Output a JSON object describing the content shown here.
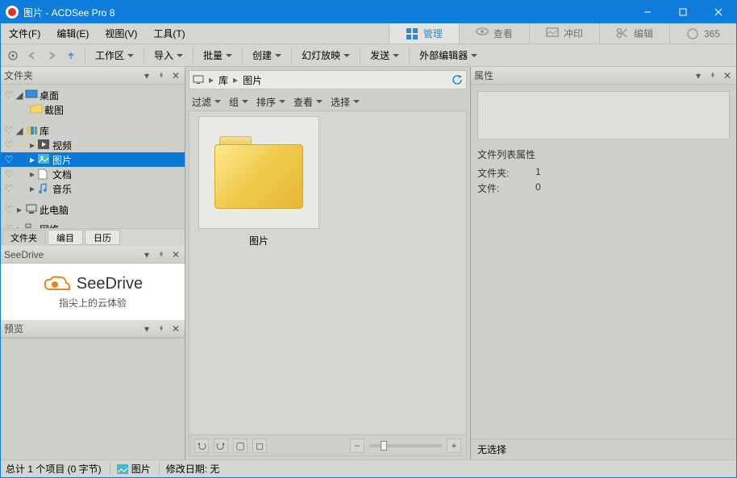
{
  "title": "图片 - ACDSee Pro 8",
  "menu": [
    "文件(F)",
    "编辑(E)",
    "视图(V)",
    "工具(T)"
  ],
  "modes": {
    "manage": "管理",
    "view": "查看",
    "develop": "冲印",
    "edit": "编辑",
    "365": "365"
  },
  "toolbar": {
    "workspace": "工作区",
    "import": "导入",
    "batch": "批量",
    "create": "创建",
    "slide": "幻灯放映",
    "send": "发送",
    "external": "外部编辑器"
  },
  "folders_panel": {
    "title": "文件夹"
  },
  "tree": {
    "desktop": "桌面",
    "screenshots": "截图",
    "library": "库",
    "videos": "视频",
    "pictures": "图片",
    "documents": "文档",
    "music": "音乐",
    "thispc": "此电脑",
    "network": "网络"
  },
  "left_tabs": {
    "folders": "文件夹",
    "catalog": "编目",
    "calendar": "日历"
  },
  "seedrive_panel": {
    "title": "SeeDrive",
    "brand": "SeeDrive",
    "tagline": "指尖上的云体验"
  },
  "preview_panel": {
    "title": "预览"
  },
  "breadcrumb": {
    "lib": "库",
    "pictures": "图片"
  },
  "filters": {
    "filter": "过滤",
    "group": "组",
    "sort": "排序",
    "view": "查看",
    "select": "选择"
  },
  "item": {
    "label": "图片"
  },
  "props_panel": {
    "title": "属性",
    "section": "文件列表属性",
    "folders_k": "文件夹:",
    "folders_v": "1",
    "files_k": "文件:",
    "files_v": "0",
    "nosel": "无选择"
  },
  "status": {
    "count": "总计 1 个项目 (0 字节)",
    "name": "图片",
    "modified": "修改日期: 无"
  }
}
